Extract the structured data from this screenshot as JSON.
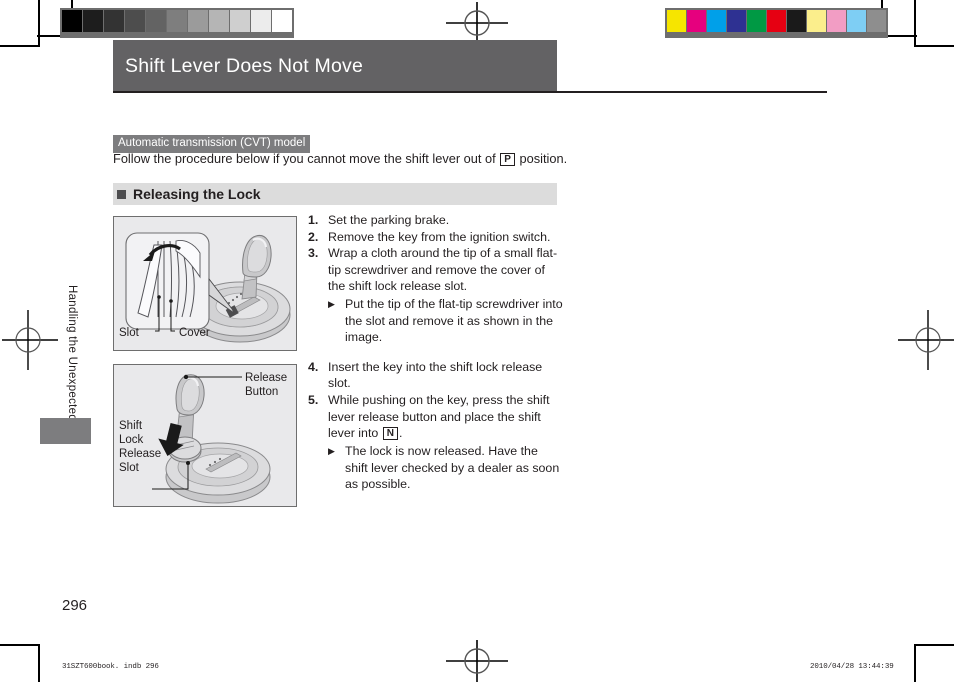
{
  "page": {
    "title": "Shift Lever Does Not Move",
    "folio": "296",
    "running_head": "Handling the Unexpected",
    "footer_left": "31SZT600book. indb    296",
    "footer_right": "2010/04/28    13:44:39"
  },
  "intro": {
    "tagline": "Automatic transmission (CVT) model",
    "text_before": "Follow the procedure below if you cannot move the shift lever out of",
    "keycap": "P",
    "text_after": "position."
  },
  "section": {
    "heading": "Releasing the Lock"
  },
  "steps": [
    {
      "num": "1.",
      "text": "Set the parking brake."
    },
    {
      "num": "2.",
      "text": "Remove the key from the ignition switch."
    },
    {
      "num": "3.",
      "text": "Wrap a cloth around the tip of a small flat-tip screwdriver and remove the cover of the shift lock release slot.",
      "sub": "Put the tip of the flat-tip screwdriver into the slot and remove it as shown in the image."
    },
    {
      "num": "4.",
      "text": "Insert the key into the shift lock release slot."
    },
    {
      "num": "5.",
      "text_before": "While pushing on the key, press the shift lever release button and place the shift lever into",
      "keycap": "N",
      "text_after": ".",
      "sub": "The lock is now released. Have the shift lever checked by a dealer as soon as possible."
    }
  ],
  "figure1": {
    "label_slot": "Slot",
    "label_cover": "Cover"
  },
  "figure2": {
    "label_release_button_line1": "Release",
    "label_release_button_line2": "Button",
    "label_slot_line1": "Shift",
    "label_slot_line2": "Lock",
    "label_slot_line3": "Release",
    "label_slot_line4": "Slot"
  },
  "calibration": {
    "grayscale": [
      "#000000",
      "#1d1d1d",
      "#333333",
      "#4d4d4d",
      "#636363",
      "#7e7e7e",
      "#9b9b9b",
      "#b5b5b5",
      "#cfcfcf",
      "#ececec",
      "#ffffff"
    ],
    "colors": [
      "#f6e500",
      "#e6007e",
      "#00a0e9",
      "#2e3192",
      "#009944",
      "#e60012",
      "#1a1a1a",
      "#fbee8c",
      "#f29dc4",
      "#7ecef4",
      "#8e8e8e"
    ]
  },
  "theme": {
    "title_bar": "#636264",
    "tagline_bg": "#7d7d7f",
    "section_bg": "#dcdcdc",
    "figure_bg": "#e9e9eb",
    "text": "#231f20"
  }
}
